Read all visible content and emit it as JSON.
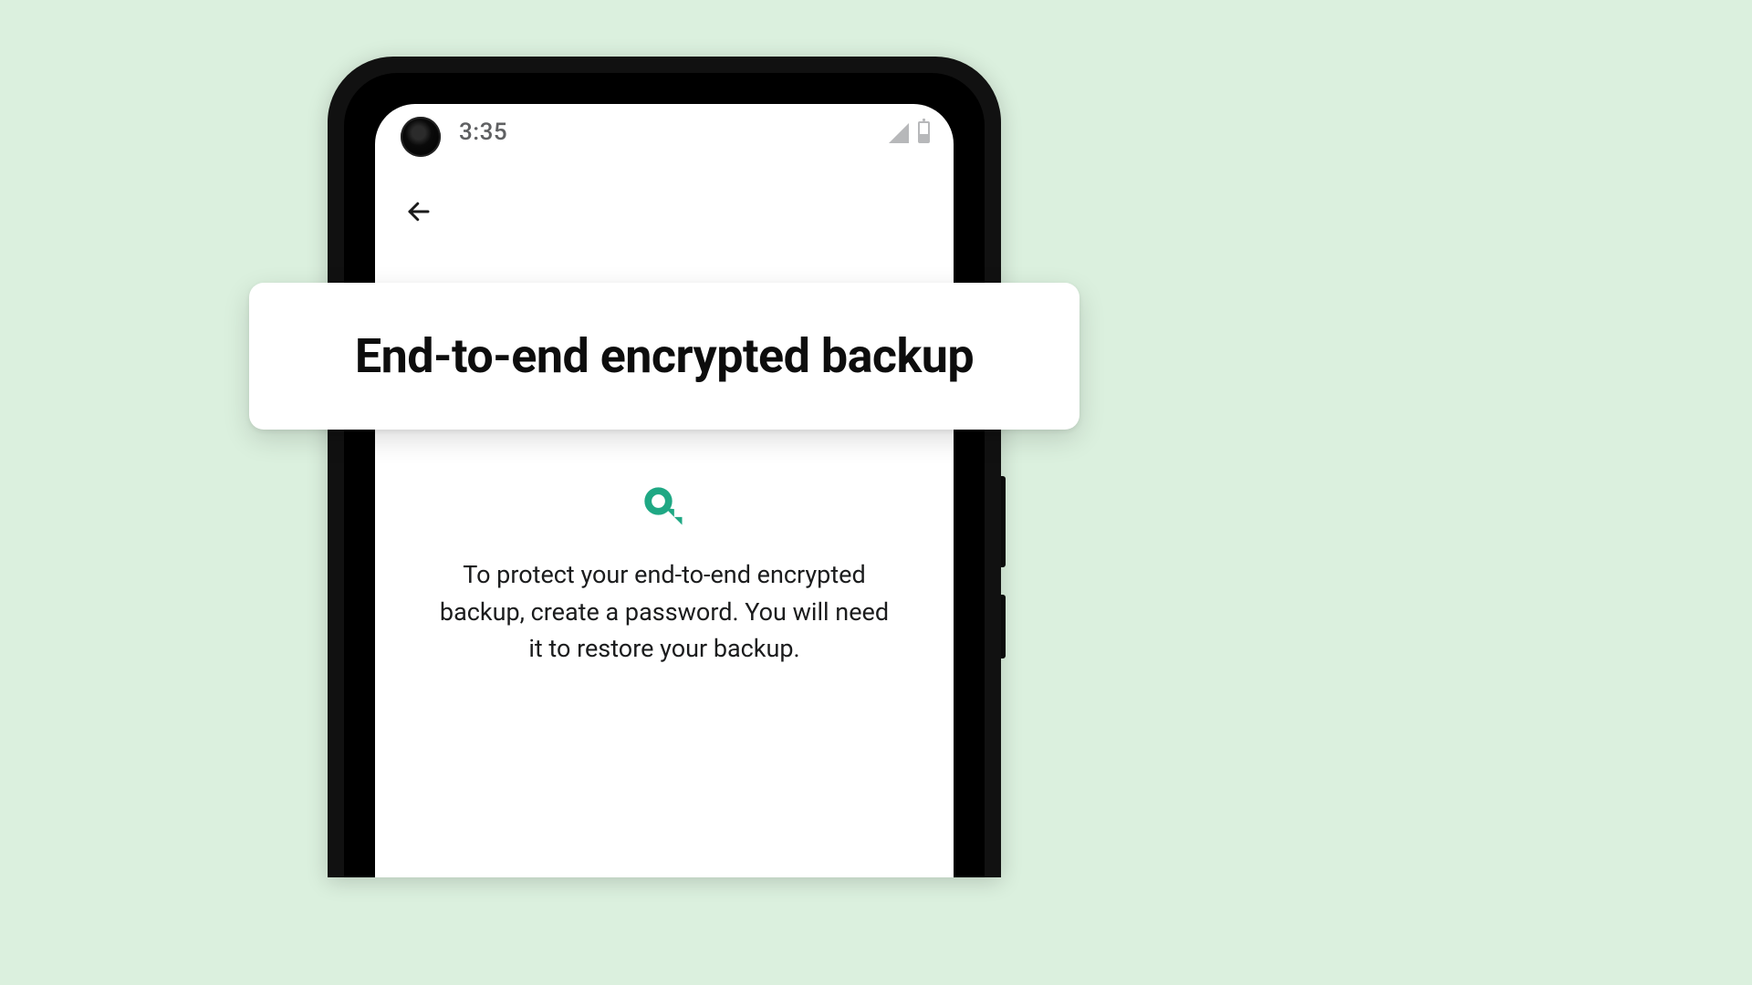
{
  "status_bar": {
    "time": "3:35"
  },
  "screen": {
    "title": "End-to-end encrypted backup",
    "body": "To protect your end-to-end encrypted backup, create a password. You will need it to restore your backup."
  },
  "colors": {
    "accent": "#1fa884",
    "background": "#dbf0de"
  }
}
